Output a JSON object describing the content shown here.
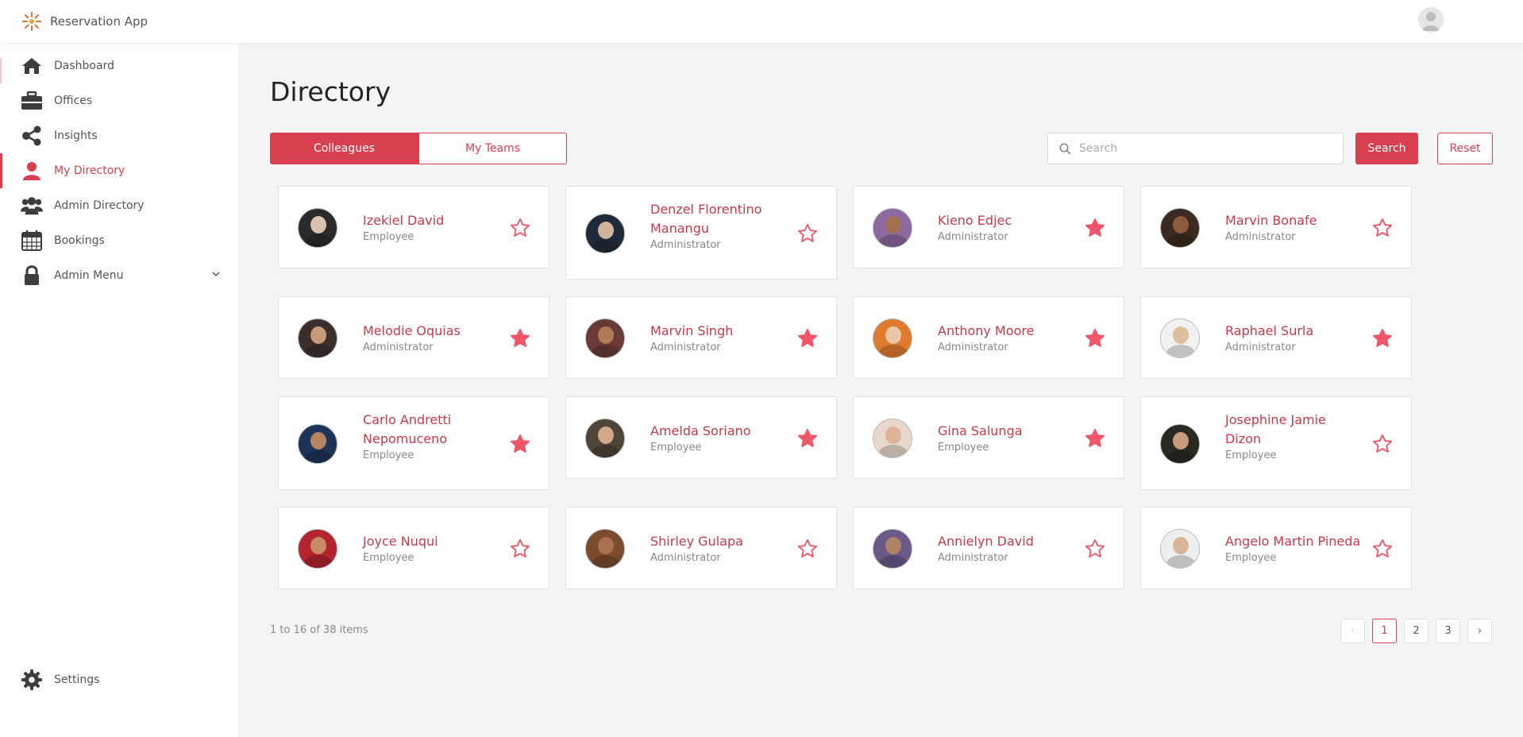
{
  "app": {
    "name": "Reservation App",
    "accent_color": "#d9404f"
  },
  "sidebar": {
    "items": [
      {
        "label": "Dashboard",
        "icon": "home-icon"
      },
      {
        "label": "Offices",
        "icon": "briefcase-icon"
      },
      {
        "label": "Insights",
        "icon": "share-nodes-icon"
      },
      {
        "label": "My Directory",
        "icon": "user-icon"
      },
      {
        "label": "Admin Directory",
        "icon": "users-icon"
      },
      {
        "label": "Bookings",
        "icon": "calendar-icon"
      },
      {
        "label": "Admin Menu",
        "icon": "lock-icon"
      }
    ],
    "settings_label": "Settings"
  },
  "page": {
    "title": "Directory",
    "tabs": [
      "Colleagues",
      "My Teams"
    ],
    "search_placeholder": "Search",
    "search_button": "Search",
    "reset_button": "Reset"
  },
  "people": [
    {
      "name": "Izekiel David",
      "role": "Employee",
      "favorite": false
    },
    {
      "name": "Denzel Florentino Manangu",
      "role": "Administrator",
      "favorite": false
    },
    {
      "name": "Kieno Edjec",
      "role": "Administrator",
      "favorite": true
    },
    {
      "name": "Marvin Bonafe",
      "role": "Administrator",
      "favorite": false
    },
    {
      "name": "Melodie Oquias",
      "role": "Administrator",
      "favorite": true
    },
    {
      "name": "Marvin Singh",
      "role": "Administrator",
      "favorite": true
    },
    {
      "name": "Anthony Moore",
      "role": "Administrator",
      "favorite": true
    },
    {
      "name": "Raphael Surla",
      "role": "Administrator",
      "favorite": true
    },
    {
      "name": "Carlo Andretti Nepomuceno",
      "role": "Employee",
      "favorite": true
    },
    {
      "name": "Amelda Soriano",
      "role": "Employee",
      "favorite": true
    },
    {
      "name": "Gina Salunga",
      "role": "Employee",
      "favorite": true
    },
    {
      "name": "Josephine Jamie Dizon",
      "role": "Employee",
      "favorite": false
    },
    {
      "name": "Joyce Nuqui",
      "role": "Employee",
      "favorite": false
    },
    {
      "name": "Shirley Gulapa",
      "role": "Administrator",
      "favorite": false
    },
    {
      "name": "Annielyn David",
      "role": "Administrator",
      "favorite": false
    },
    {
      "name": "Angelo Martin Pineda",
      "role": "Employee",
      "favorite": false
    }
  ],
  "pagination": {
    "summary": "1 to 16 of 38 items",
    "prev": "‹",
    "next": "›",
    "pages": [
      "1",
      "2",
      "3"
    ],
    "current": "1"
  }
}
